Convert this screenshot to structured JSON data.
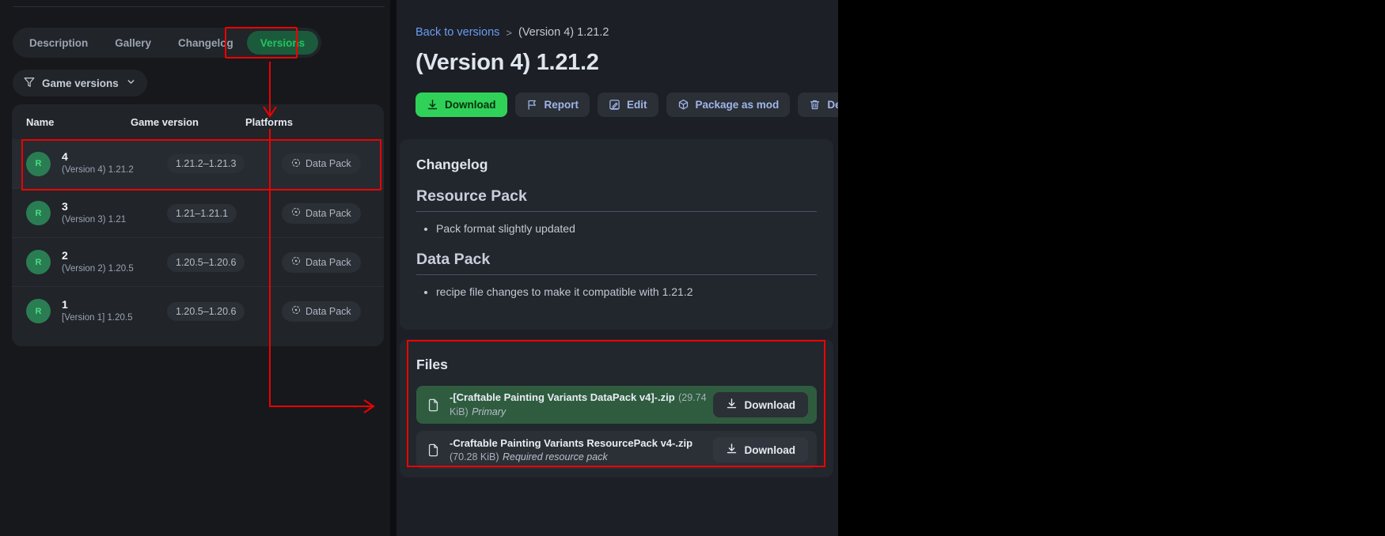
{
  "left": {
    "tabs": [
      {
        "label": "Description",
        "active": false
      },
      {
        "label": "Gallery",
        "active": false
      },
      {
        "label": "Changelog",
        "active": false
      },
      {
        "label": "Versions",
        "active": true
      }
    ],
    "filter_button": "Game versions",
    "filter_icon": "funnel-icon",
    "chevron_icon": "chevron-down-icon",
    "table": {
      "headers": [
        "Name",
        "Game version",
        "Platforms"
      ],
      "rows": [
        {
          "avatar": "R",
          "number": "4",
          "subtitle": "(Version 4) 1.21.2",
          "game_version": "1.21.2–1.21.3",
          "platform": "Data Pack",
          "selected": true
        },
        {
          "avatar": "R",
          "number": "3",
          "subtitle": "(Version 3) 1.21",
          "game_version": "1.21–1.21.1",
          "platform": "Data Pack",
          "selected": false
        },
        {
          "avatar": "R",
          "number": "2",
          "subtitle": "(Version 2) 1.20.5",
          "game_version": "1.20.5–1.20.6",
          "platform": "Data Pack",
          "selected": false
        },
        {
          "avatar": "R",
          "number": "1",
          "subtitle": "[Version 1] 1.20.5",
          "game_version": "1.20.5–1.20.6",
          "platform": "Data Pack",
          "selected": false
        }
      ]
    }
  },
  "right": {
    "breadcrumb": {
      "link": "Back to versions",
      "separator": ">",
      "current": "(Version 4) 1.21.2"
    },
    "title": "(Version 4) 1.21.2",
    "actions": [
      {
        "label": "Download",
        "icon": "download-icon",
        "style": "primary"
      },
      {
        "label": "Report",
        "icon": "flag-icon",
        "style": "default"
      },
      {
        "label": "Edit",
        "icon": "pencil-square-icon",
        "style": "default"
      },
      {
        "label": "Package as mod",
        "icon": "cube-icon",
        "style": "default"
      },
      {
        "label": "Delete",
        "icon": "trash-icon",
        "style": "default"
      }
    ],
    "changelog": {
      "heading": "Changelog",
      "sections": [
        {
          "title": "Resource Pack",
          "items": [
            "Pack format slightly updated"
          ]
        },
        {
          "title": "Data Pack",
          "items": [
            "recipe file changes to make it compatible with 1.21.2"
          ]
        }
      ]
    },
    "files": {
      "heading": "Files",
      "items": [
        {
          "name": "-[Craftable Painting Variants DataPack v4]-.zip",
          "size": "(29.74 KiB)",
          "tag": "Primary",
          "download_label": "Download",
          "icon": "document-icon",
          "primary": true
        },
        {
          "name": "-Craftable Painting Variants ResourcePack v4-.zip",
          "size": "(70.28 KiB)",
          "tag": "Required resource pack",
          "download_label": "Download",
          "icon": "document-icon",
          "primary": false
        }
      ]
    }
  },
  "annotations": {
    "accent_color": "#ef0000",
    "boxes": [
      "versions-tab",
      "selected-version-row",
      "files-section"
    ],
    "arrows": [
      "versions-tab-to-table",
      "table-to-files"
    ]
  }
}
